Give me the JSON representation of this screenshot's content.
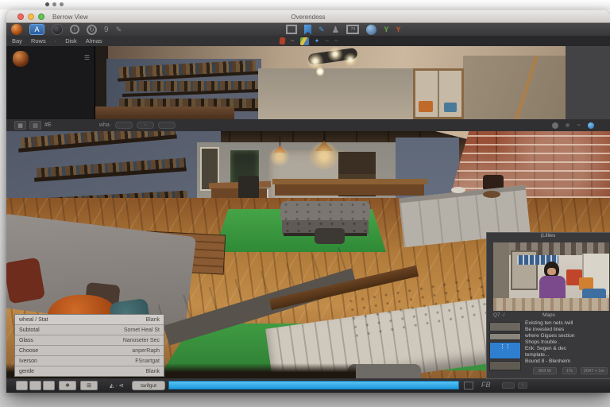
{
  "chrome": {
    "title_left": "Berrow View",
    "title_center": "Overendess"
  },
  "glyphs": {
    "a_tile": "A",
    "info": "i",
    "rotate": "↻",
    "nine": "9",
    "pen": "✎",
    "pawn": "♟",
    "frame74": "74",
    "y_green": "Y",
    "y_red": "Y",
    "panel_menu": "☰",
    "blue_star": "✦",
    "wave": "~",
    "mid_grid": "▦",
    "mid_rows": "▤",
    "mid_label": "#E·",
    "mid_center_label": "wha·",
    "dock_a": "❖",
    "dock_b": "⊞",
    "footer_cluster": "◭ · ⊲",
    "bar_frame": "▨",
    "fb": "FB",
    "five": "5",
    "thumb_dots": "⋮⋮"
  },
  "subtoolbar": {
    "items": [
      "Bay",
      "Rows",
      "·",
      "Disk",
      "Almas"
    ]
  },
  "props": {
    "header": {
      "label": "wheal / Stat",
      "value": "Blank"
    },
    "rows": [
      {
        "label": "Subtotal",
        "value": "Somet Heal St"
      },
      {
        "label": "Glass",
        "value": "Nanoseter Sec"
      },
      {
        "label": "Choose",
        "value": "anperRaph"
      },
      {
        "label": "Iverson",
        "value": "FSnartgat"
      },
      {
        "label": "gentle",
        "value": "Blank"
      }
    ],
    "footer_button": "tarifgut"
  },
  "progress": {
    "fill_pct": 100,
    "color": "#2aa7e8"
  },
  "overlay": {
    "title": "(Lillies",
    "caption_left": "Q7 ·/",
    "caption_right": "Maps",
    "lines": [
      "Existing ten nets /will",
      "Be invested lines",
      "where Gigues section",
      "Shops trouble .",
      "Erik: Segen & dec",
      "template...",
      "Bound 8 - Blenheim"
    ],
    "footer": [
      "803 W",
      "1%",
      "2047 + 1m"
    ]
  },
  "scene": {
    "objects": [
      "bookshelves",
      "brick-wall",
      "parquet-floor",
      "green-rug",
      "tufted-ottoman",
      "bed-with-pillows",
      "pendant-lamps",
      "white-sideboard",
      "stained-glass-window",
      "ceiling-track-light"
    ]
  },
  "colors": {
    "accent_blue": "#2aa7e8",
    "toolbar": "#3a3a3c",
    "panel_dark": "#19191b",
    "brick": "#8c4c34",
    "rug_green": "#3f9b42",
    "floor_wood": "#b5813f"
  }
}
